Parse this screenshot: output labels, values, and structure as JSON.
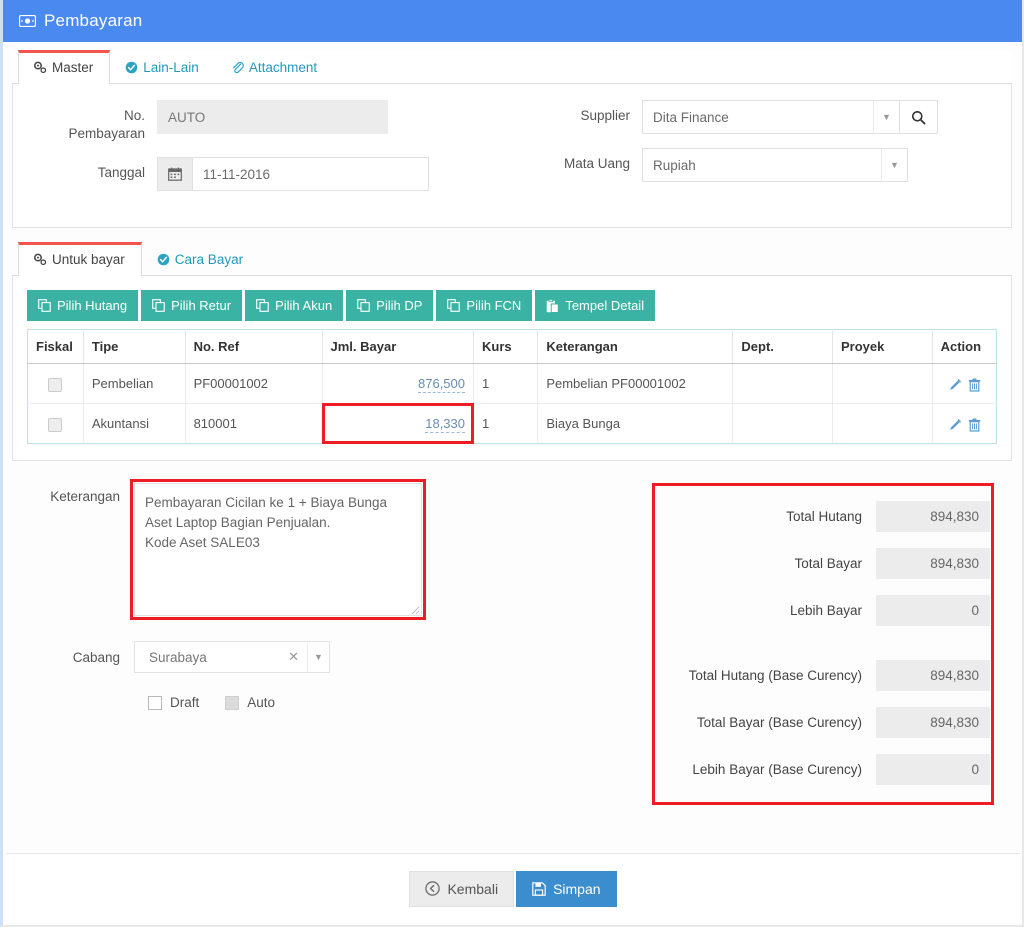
{
  "window": {
    "title": "Pembayaran",
    "title_icon": "money-bill-icon",
    "header_color": "#4a89f0",
    "accent_teal": "#3bb3a4",
    "highlight_red": "#ee1c24"
  },
  "master_tabs": [
    {
      "label": "Master",
      "icon": "gears-icon",
      "active": true
    },
    {
      "label": "Lain-Lain",
      "icon": "check-circle-icon",
      "active": false
    },
    {
      "label": "Attachment",
      "icon": "paperclip-icon",
      "active": false
    }
  ],
  "master_form": {
    "no_pembayaran": {
      "label_line1": "No.",
      "label_line2": "Pembayaran",
      "value": "AUTO"
    },
    "tanggal": {
      "label": "Tanggal",
      "value": "11-11-2016",
      "icon": "calendar-icon"
    },
    "supplier": {
      "label": "Supplier",
      "value": "Dita Finance",
      "search_icon": "search-icon"
    },
    "mata_uang": {
      "label": "Mata Uang",
      "value": "Rupiah"
    }
  },
  "detail_tabs": [
    {
      "label": "Untuk bayar",
      "icon": "gears-icon",
      "active": true
    },
    {
      "label": "Cara Bayar",
      "icon": "check-circle-icon",
      "active": false
    }
  ],
  "toolbar": [
    {
      "label": "Pilih Hutang",
      "icon": "copy-icon"
    },
    {
      "label": "Pilih Retur",
      "icon": "copy-icon"
    },
    {
      "label": "Pilih Akun",
      "icon": "copy-icon"
    },
    {
      "label": "Pilih DP",
      "icon": "copy-icon"
    },
    {
      "label": "Pilih FCN",
      "icon": "copy-icon"
    },
    {
      "label": "Tempel Detail",
      "icon": "paste-icon"
    }
  ],
  "table": {
    "columns": [
      "Fiskal",
      "Tipe",
      "No. Ref",
      "Jml. Bayar",
      "Kurs",
      "Keterangan",
      "Dept.",
      "Proyek",
      "Action"
    ],
    "rows": [
      {
        "fiskal_checked": false,
        "tipe": "Pembelian",
        "no_ref": "PF00001002",
        "jml_bayar": "876,500",
        "kurs": "1",
        "keterangan": "Pembelian PF00001002",
        "dept": "",
        "proyek": "",
        "highlighted": false
      },
      {
        "fiskal_checked": false,
        "tipe": "Akuntansi",
        "no_ref": "810001",
        "jml_bayar": "18,330",
        "kurs": "1",
        "keterangan": "Biaya Bunga",
        "dept": "",
        "proyek": "",
        "highlighted": true
      }
    ],
    "action_icons": [
      "pencil-icon",
      "trash-icon"
    ]
  },
  "keterangan": {
    "label": "Keterangan",
    "value": "Pembayaran Cicilan ke 1 + Biaya Bunga\nAset Laptop Bagian Penjualan.\nKode Aset SALE03"
  },
  "cabang": {
    "label": "Cabang",
    "value": "Surabaya",
    "clear_icon": "clear-x-icon",
    "caret_icon": "chevron-down-icon"
  },
  "checkboxes": [
    {
      "label": "Draft",
      "checked": false,
      "disabled": false
    },
    {
      "label": "Auto",
      "checked": false,
      "disabled": true
    }
  ],
  "totals": [
    {
      "label": "Total Hutang",
      "value": "894,830",
      "spaced": false
    },
    {
      "label": "Total Bayar",
      "value": "894,830",
      "spaced": false
    },
    {
      "label": "Lebih Bayar",
      "value": "0",
      "spaced": false
    },
    {
      "label": "Total Hutang (Base Curency)",
      "value": "894,830",
      "spaced": true
    },
    {
      "label": "Total Bayar (Base Curency)",
      "value": "894,830",
      "spaced": false
    },
    {
      "label": "Lebih Bayar (Base Curency)",
      "value": "0",
      "spaced": false
    }
  ],
  "footer": {
    "back": {
      "label": "Kembali",
      "icon": "arrow-circle-left-icon"
    },
    "save": {
      "label": "Simpan",
      "icon": "floppy-disk-icon"
    }
  }
}
